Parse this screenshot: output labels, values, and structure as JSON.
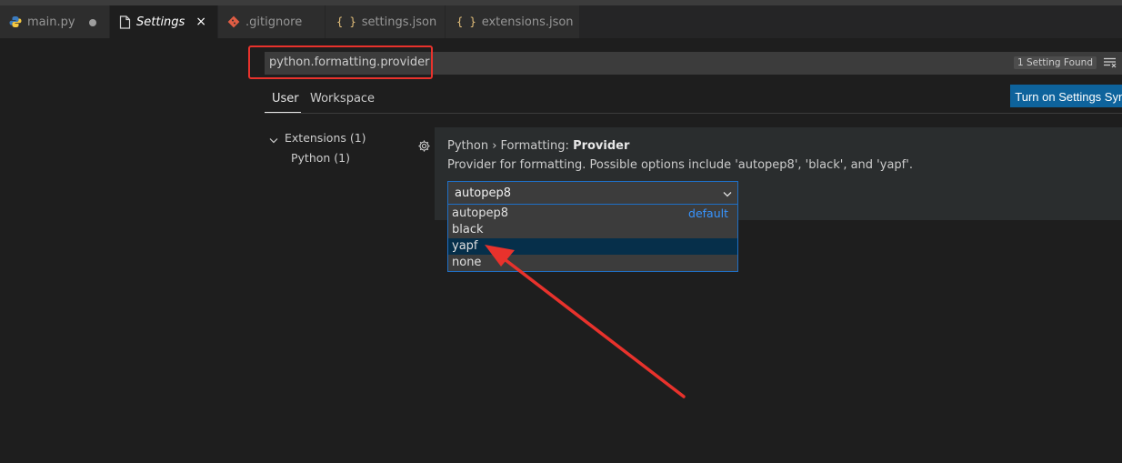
{
  "tabs": [
    {
      "label": "main.py",
      "icon": "python-icon",
      "state": "modified"
    },
    {
      "label": "Settings",
      "icon": "file-icon",
      "state": "active",
      "close": "×"
    },
    {
      "label": ".gitignore",
      "icon": "git-icon"
    },
    {
      "label": "settings.json",
      "icon": "json-braces-icon",
      "braces": "{ }"
    },
    {
      "label": "extensions.json",
      "icon": "json-braces-icon",
      "braces": "{ }"
    }
  ],
  "search": {
    "value": "python.formatting.provider",
    "result_count": "1 Setting Found"
  },
  "scope_tabs": {
    "user": "User",
    "workspace": "Workspace"
  },
  "sync_button": "Turn on Settings Sync",
  "toc": {
    "extensions": "Extensions (1)",
    "python": "Python (1)"
  },
  "setting": {
    "title_prefix": "Python › Formatting: ",
    "title_name": "Provider",
    "description": "Provider for formatting. Possible options include 'autopep8', 'black', and 'yapf'.",
    "selected_value": "autopep8",
    "options": [
      {
        "label": "autopep8",
        "badge": "default"
      },
      {
        "label": "black"
      },
      {
        "label": "yapf"
      },
      {
        "label": "none"
      }
    ],
    "highlighted_option": "yapf"
  },
  "colors": {
    "accent": "#0e639c",
    "annotation": "#e8322c",
    "focus_border": "#1f6fc5"
  }
}
